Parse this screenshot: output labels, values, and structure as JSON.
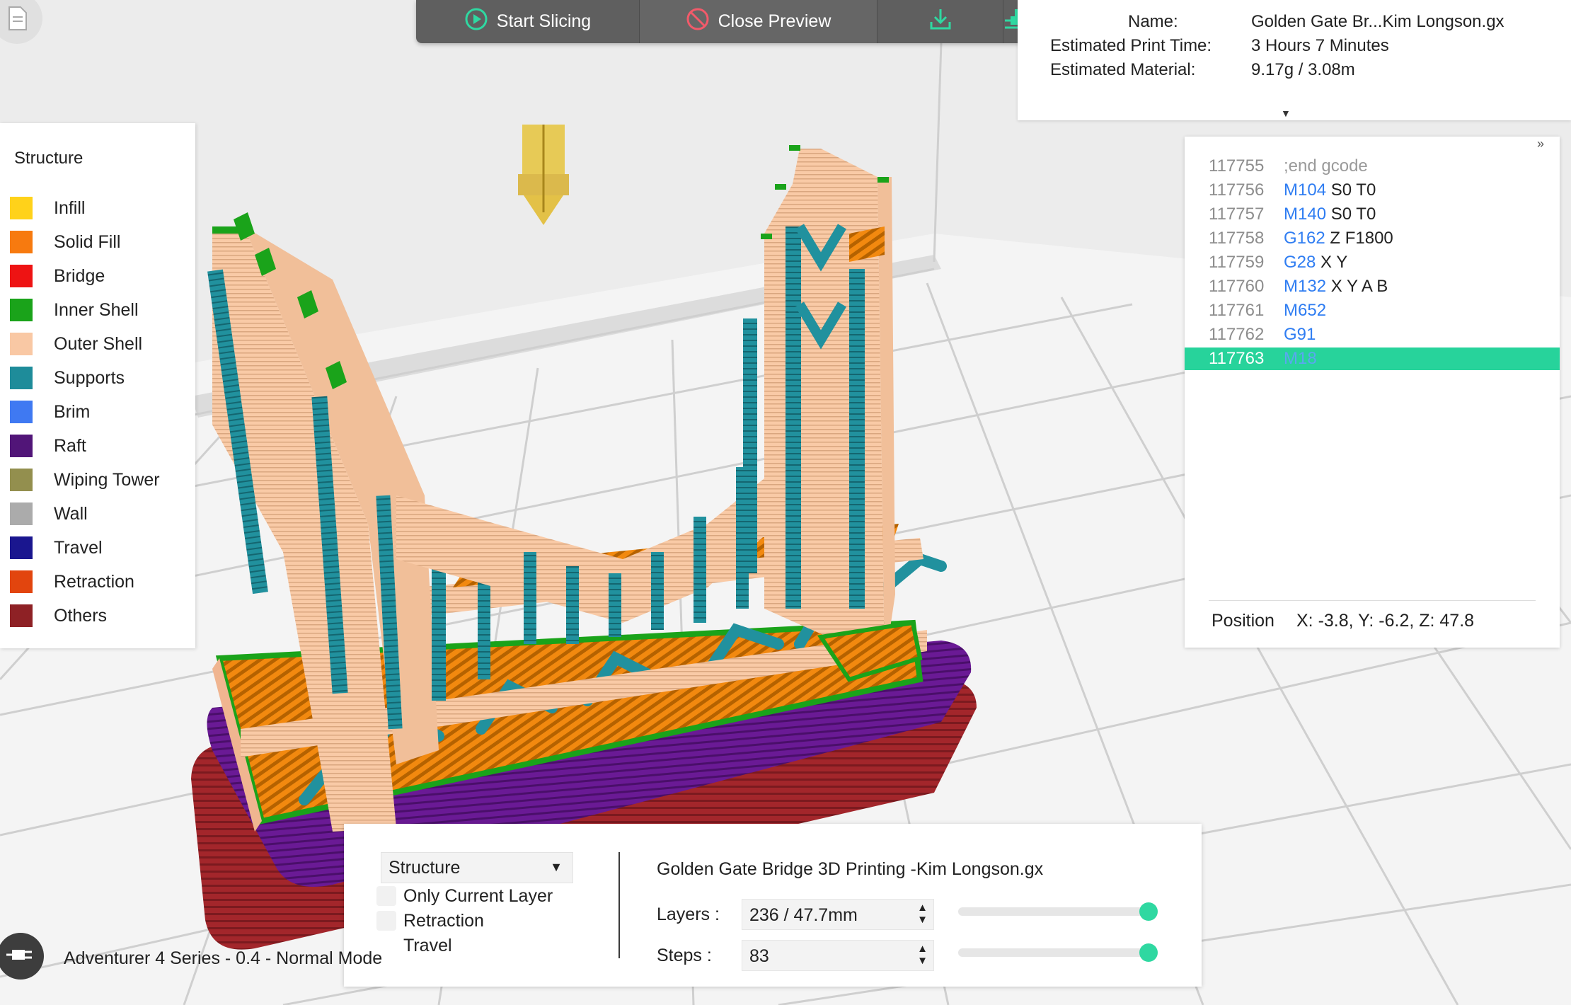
{
  "toolbar": {
    "start_slicing": "Start Slicing",
    "close_preview": "Close Preview",
    "export_icon": "download-icon",
    "print_icon": "send-to-printer-icon"
  },
  "print_info": {
    "name_label": "Name:",
    "name_value": "Golden Gate Br...Kim Longson.gx",
    "time_label": "Estimated Print Time:",
    "time_value": "3 Hours 7 Minutes",
    "material_label": "Estimated Material:",
    "material_value": "9.17g / 3.08m"
  },
  "legend": {
    "title": "Structure",
    "items": [
      {
        "label": "Infill",
        "color": "#FFD21A"
      },
      {
        "label": "Solid Fill",
        "color": "#F77A0F"
      },
      {
        "label": "Bridge",
        "color": "#EE1313"
      },
      {
        "label": "Inner Shell",
        "color": "#1AA31A"
      },
      {
        "label": "Outer Shell",
        "color": "#F9C8A4"
      },
      {
        "label": "Supports",
        "color": "#1E8C9A"
      },
      {
        "label": "Brim",
        "color": "#3F79F2"
      },
      {
        "label": "Raft",
        "color": "#511578"
      },
      {
        "label": "Wiping Tower",
        "color": "#938F4E"
      },
      {
        "label": "Wall",
        "color": "#ABABAB"
      },
      {
        "label": "Travel",
        "color": "#1A168F"
      },
      {
        "label": "Retraction",
        "color": "#E2450E"
      },
      {
        "label": "Others",
        "color": "#8E2125"
      }
    ]
  },
  "gcode": {
    "lines": [
      {
        "num": "117755",
        "cmd": "",
        "args": ";end gcode",
        "comment": true
      },
      {
        "num": "117756",
        "cmd": "M104",
        "args": " S0 T0"
      },
      {
        "num": "117757",
        "cmd": "M140",
        "args": " S0 T0"
      },
      {
        "num": "117758",
        "cmd": "G162",
        "args": " Z F1800"
      },
      {
        "num": "117759",
        "cmd": "G28",
        "args": " X Y"
      },
      {
        "num": "117760",
        "cmd": "M132",
        "args": " X Y A B"
      },
      {
        "num": "117761",
        "cmd": "M652",
        "args": ""
      },
      {
        "num": "117762",
        "cmd": "G91",
        "args": ""
      },
      {
        "num": "117763",
        "cmd": "M18",
        "args": "",
        "selected": true
      }
    ],
    "position_label": "Position",
    "position_value": "X: -3.8, Y: -6.2, Z: 47.8"
  },
  "preview": {
    "view_mode": "Structure",
    "checkboxes": [
      "Only Current Layer",
      "Retraction",
      "Travel"
    ],
    "file_title": "Golden Gate Bridge 3D Printing -Kim Longson.gx",
    "layers_label": "Layers :",
    "layers_value": "236 / 47.7mm",
    "layers_fraction": 1.0,
    "steps_label": "Steps :",
    "steps_value": "83",
    "steps_fraction": 1.0
  },
  "status": {
    "text": "Adventurer 4 Series - 0.4 - Normal Mode"
  }
}
